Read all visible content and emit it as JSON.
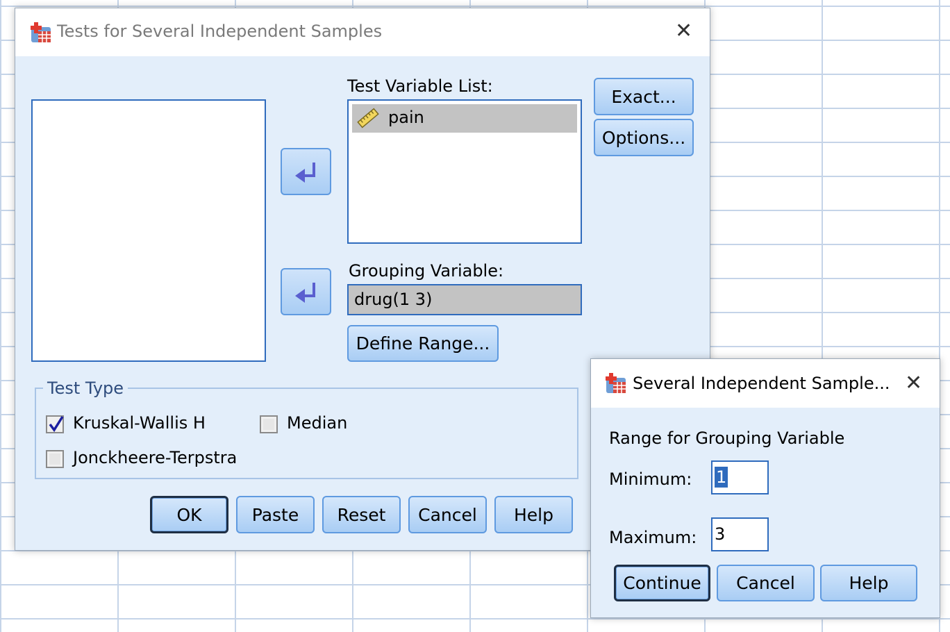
{
  "main_dialog": {
    "title": "Tests for Several Independent Samples",
    "test_variable_list_label": "Test Variable List:",
    "test_variables": [
      "pain"
    ],
    "grouping_variable_label": "Grouping Variable:",
    "grouping_variable_value": "drug(1 3)",
    "define_range_button": "Define Range...",
    "exact_button": "Exact...",
    "options_button": "Options...",
    "test_type": {
      "legend": "Test Type",
      "options": [
        {
          "label": "Kruskal-Wallis H",
          "checked": true
        },
        {
          "label": "Median",
          "checked": false
        },
        {
          "label": "Jonckheere-Terpstra",
          "checked": false
        }
      ]
    },
    "buttons": {
      "ok": "OK",
      "paste": "Paste",
      "reset": "Reset",
      "cancel": "Cancel",
      "help": "Help"
    }
  },
  "range_dialog": {
    "title": "Several Independent Sample...",
    "heading": "Range for Grouping Variable",
    "minimum_label": "Minimum:",
    "minimum_value": "1",
    "maximum_label": "Maximum:",
    "maximum_value": "3",
    "buttons": {
      "continue": "Continue",
      "cancel": "Cancel",
      "help": "Help"
    }
  },
  "colors": {
    "dialog_bg": "#e3eefa",
    "accent_border": "#2f6bbd",
    "button_top": "#d5e7fb",
    "button_bottom": "#a9cdf4",
    "legend_text": "#2e4c7d",
    "arrow_fill": "#5a5fcf"
  },
  "icons": [
    "spss-app-icon",
    "close-icon",
    "ruler-icon",
    "arrow-left-icon",
    "checkmark-icon"
  ]
}
